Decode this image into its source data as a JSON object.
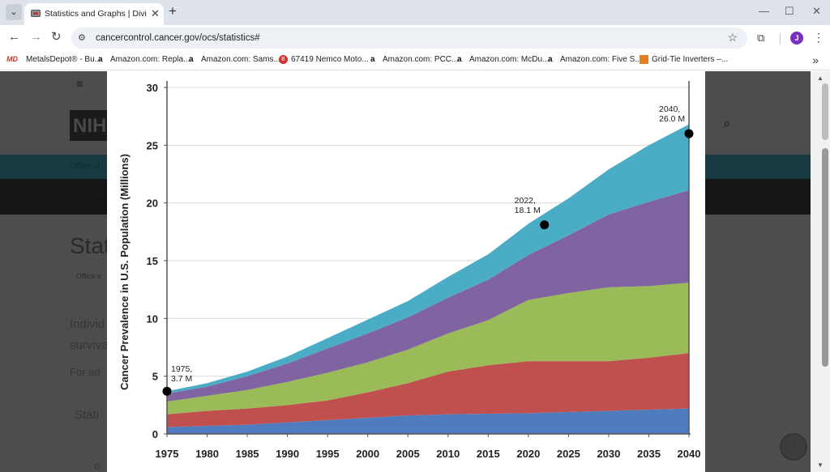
{
  "browser": {
    "tab_title": "Statistics and Graphs | Division",
    "new_tab": "+",
    "tab_menu": "⌄",
    "tab_close": "✕",
    "window_controls": [
      "—",
      "☐",
      "✕"
    ],
    "url": "cancercontrol.cancer.gov/ocs/statistics#",
    "profile_initial": "J"
  },
  "bookmarks": [
    {
      "icon": "MD",
      "label": "MetalsDepot® - Bu..."
    },
    {
      "icon": "a",
      "label": "Amazon.com: Repla..."
    },
    {
      "icon": "a",
      "label": "Amazon.com: Sams..."
    },
    {
      "icon": "B",
      "label": "67419 Nemco Moto..."
    },
    {
      "icon": "a",
      "label": "Amazon.com: PCC..."
    },
    {
      "icon": "a",
      "label": "Amazon.com: McDu..."
    },
    {
      "icon": "a",
      "label": "Amazon.com: Five S..."
    },
    {
      "icon": "grid",
      "label": "Grid-Tie Inverters –..."
    }
  ],
  "page_background": {
    "logo_text": "NIH",
    "fragments": [
      "Office of",
      "OCS H",
      "Stat",
      "Office o",
      "Individ",
      "surviva",
      "For ad",
      "Stati",
      "CI"
    ]
  },
  "chart_data": {
    "type": "area",
    "title": "",
    "xlabel": "",
    "ylabel": "Cancer Prevalence in U.S. Population (Millions)",
    "x": [
      1975,
      1980,
      1985,
      1990,
      1995,
      2000,
      2005,
      2010,
      2015,
      2020,
      2025,
      2030,
      2035,
      2040
    ],
    "xticks": [
      1975,
      1980,
      1985,
      1990,
      1995,
      2000,
      2005,
      2010,
      2015,
      2020,
      2025,
      2030,
      2035,
      2040
    ],
    "ylim": [
      0,
      30
    ],
    "yticks": [
      0,
      5,
      10,
      15,
      20,
      25,
      30
    ],
    "grid": true,
    "stacked": true,
    "series": [
      {
        "color": "#4f7bbf",
        "values": [
          0.6,
          0.7,
          0.8,
          1.0,
          1.2,
          1.4,
          1.6,
          1.7,
          1.75,
          1.8,
          1.9,
          2.0,
          2.1,
          2.2
        ]
      },
      {
        "color": "#c0504d",
        "values": [
          1.1,
          1.3,
          1.4,
          1.5,
          1.7,
          2.2,
          2.8,
          3.7,
          4.2,
          4.5,
          4.4,
          4.3,
          4.5,
          4.8
        ]
      },
      {
        "color": "#9bbb59",
        "values": [
          1.1,
          1.3,
          1.6,
          2.0,
          2.4,
          2.6,
          2.9,
          3.3,
          3.9,
          5.3,
          5.9,
          6.4,
          6.2,
          6.1
        ]
      },
      {
        "color": "#8064a2",
        "values": [
          0.7,
          0.8,
          1.2,
          1.6,
          2.1,
          2.5,
          2.8,
          3.1,
          3.5,
          3.9,
          5.0,
          6.3,
          7.3,
          8.0
        ]
      },
      {
        "color": "#4bacc6",
        "values": [
          0.2,
          0.3,
          0.4,
          0.6,
          0.9,
          1.2,
          1.4,
          1.8,
          2.2,
          2.7,
          3.2,
          3.9,
          4.9,
          5.7
        ]
      }
    ],
    "annotations": [
      {
        "x": 1975,
        "y": 3.7,
        "label_year": "1975,",
        "label_value": "3.7 M"
      },
      {
        "x": 2022,
        "y": 18.1,
        "label_year": "2022,",
        "label_value": "18.1 M"
      },
      {
        "x": 2040,
        "y": 26.0,
        "label_year": "2040,",
        "label_value": "26.0 M"
      }
    ]
  }
}
